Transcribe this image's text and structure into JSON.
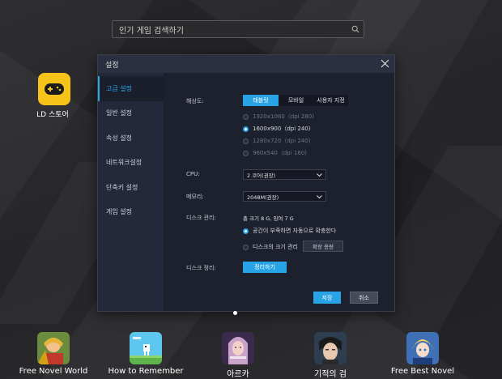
{
  "search": {
    "placeholder": "인기 게임 검색하기"
  },
  "ld_store": {
    "label": "LD 스토어"
  },
  "dock": [
    {
      "label": "Free Novel World",
      "icon": "fairy-tale-game-icon"
    },
    {
      "label": "How to Remember",
      "icon": "pixel-runner-game-icon"
    },
    {
      "label": "아르카",
      "icon": "arca-game-icon"
    },
    {
      "label": "기적의 검",
      "icon": "sword-game-icon"
    },
    {
      "label": "Free Best Novel",
      "icon": "anime-knight-game-icon"
    }
  ],
  "dialog": {
    "title": "설정",
    "sidebar": [
      "고급 설정",
      "일반 설정",
      "속성 설정",
      "네트워크설정",
      "단축키 설정",
      "게임 설정"
    ],
    "resolution": {
      "label": "해상도:",
      "tabs": [
        "태블릿",
        "모바일",
        "사용자 지정"
      ],
      "options": [
        "1920x1080（dpi 280)",
        "1600x900（dpi 240)",
        "1280x720（dpi 240)",
        "960x540（dpi 160)"
      ]
    },
    "cpu": {
      "label": "CPU:",
      "value": "2 코어(권장)"
    },
    "memory": {
      "label": "메모리:",
      "value": "2048M(권장)"
    },
    "disk": {
      "label": "디스크 관리:",
      "info": "총 크기 8 G,  잉여 7 G",
      "option_auto": "공간이 부족하면 자동으로 확충한다",
      "option_manual": "디스크의 크기 관리",
      "expand_button": "확장 용량"
    },
    "cleanup": {
      "label": "디스크 정리:",
      "button": "정리하기"
    },
    "save_button": "저장",
    "cancel_button": "취소"
  },
  "colors": {
    "accent": "#27a3e6",
    "store_yellow": "#f6c319"
  }
}
